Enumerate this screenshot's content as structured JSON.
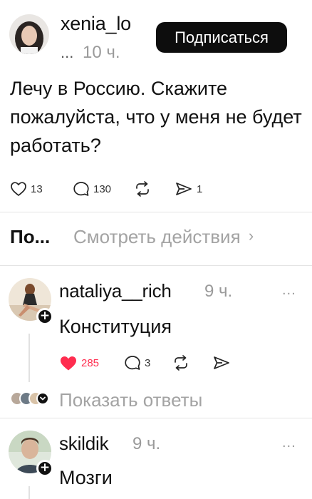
{
  "post": {
    "author": "xenia_lo",
    "time_prefix": "...",
    "time": "10 ч.",
    "follow_label": "Подписаться",
    "text": "Лечу в Россию. Скажите пожалуйста, что у меня не будет работать?",
    "likes": "13",
    "comments": "130",
    "shares": "1"
  },
  "tabs": {
    "active_label": "По...",
    "view_activity_label": "Смотреть действия",
    "chevron": "›"
  },
  "comments": [
    {
      "author": "nataliya__rich",
      "time": "9 ч.",
      "text": "Конституция",
      "likes": "285",
      "liked": true,
      "replies": "3",
      "show_replies_label": "Показать ответы"
    },
    {
      "author": "skildik",
      "time": "9 ч.",
      "text": "Мозги"
    }
  ],
  "icons": {
    "more": "...",
    "plus": "+"
  },
  "colors": {
    "like_active": "#ff2d4f",
    "muted_text": "#a3a3a3",
    "button_bg": "#0d0d0d"
  }
}
